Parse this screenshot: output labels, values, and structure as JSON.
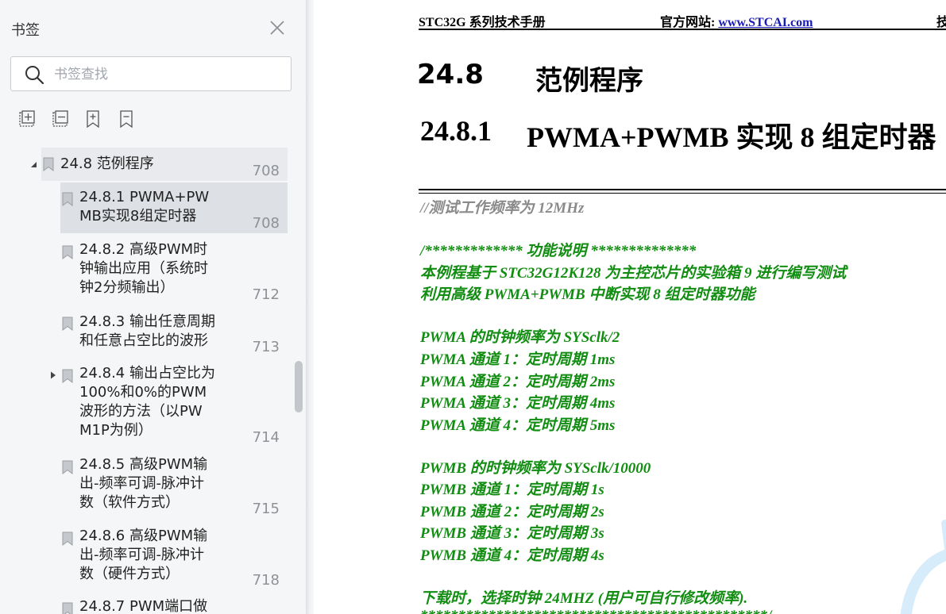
{
  "sidebar": {
    "title": "书签",
    "search_placeholder": "书签查找",
    "items": [
      {
        "label": "24.8  范例程序",
        "page": "708"
      },
      {
        "label": "24.8.1 PWMA+PW\nMB实现8组定时器",
        "page": "708"
      },
      {
        "label": "24.8.2 高级PWM时\n钟输出应用（系统时\n钟2分频输出）",
        "page": "712"
      },
      {
        "label": "24.8.3 输出任意周期\n和任意占空比的波形",
        "page": "713"
      },
      {
        "label": "24.8.4  输出占空比为\n100%和0%的PWM\n波形的方法（以PW\nM1P为例）",
        "page": "714"
      },
      {
        "label": "24.8.5 高级PWM输\n出-频率可调-脉冲计\n数（软件方式）",
        "page": "715"
      },
      {
        "label": "24.8.6 高级PWM输\n出-频率可调-脉冲计\n数（硬件方式）",
        "page": "718"
      },
      {
        "label": "24.8.7 PWM端口做",
        "page": ""
      }
    ]
  },
  "doc": {
    "header_left": "STC32G 系列技术手册",
    "header_mid_label": "官方网站: ",
    "header_mid_link": "www.STCAI.com",
    "header_right": "技",
    "h1_num": "24.8",
    "h1_title": "范例程序",
    "h2_num": "24.8.1",
    "h2_title": "PWMA+PWMB 实现 8 组定时器",
    "code": [
      "//测试工作频率为 12MHz",
      "/*************  功能说明  **************",
      "本例程基于 STC32G12K128 为主控芯片的实验箱 9 进行编写测试",
      "利用高级 PWMA+PWMB 中断实现 8 组定时器功能",
      "PWMA 的时钟频率为  SYSclk/2",
      "PWMA 通道 1：定时周期  1ms",
      "PWMA 通道 2：定时周期  2ms",
      "PWMA 通道 3：定时周期  4ms",
      "PWMA 通道 4：定时周期  5ms",
      "PWMB 的时钟频率为  SYSclk/10000",
      "PWMB 通道 1：定时周期  1s",
      "PWMB 通道 2：定时周期  2s",
      "PWMB 通道 3：定时周期  3s",
      "PWMB 通道 4：定时周期  4s",
      "下载时，选择时钟  24MHZ (用户可自行修改频率).",
      "**********************************************/"
    ]
  }
}
